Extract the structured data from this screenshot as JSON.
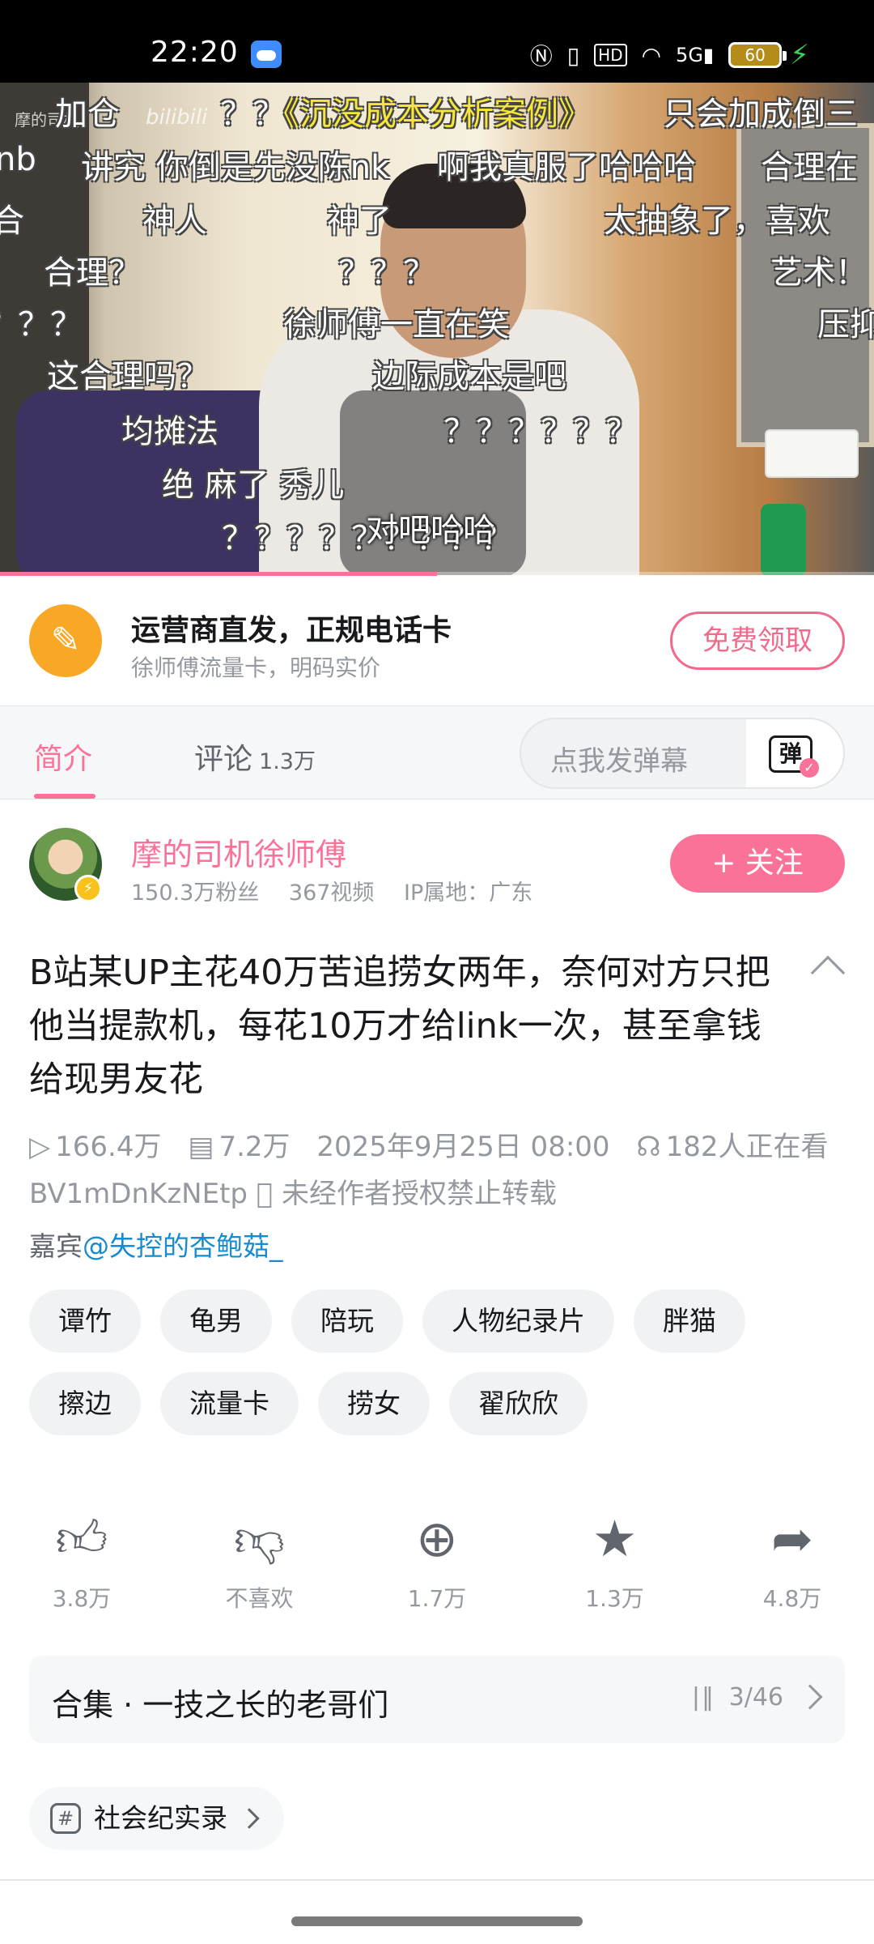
{
  "status_bar": {
    "time": "22:20",
    "battery": "60"
  },
  "video": {
    "watermark": "摩的司机",
    "watermark_logo": "bilibili",
    "subtitle": "对吧哈哈",
    "progress": 0.5,
    "danmaku": [
      {
        "text": "加仓",
        "color": "white"
      },
      {
        "text": "？？",
        "color": "white"
      },
      {
        "text": "《沉没成本分析案例》",
        "color": "yellow"
      },
      {
        "text": "只会加成倒三",
        "color": "white"
      },
      {
        "text": "nb",
        "color": "white"
      },
      {
        "text": "讲究 你倒是先没陈nk",
        "color": "white"
      },
      {
        "text": "啊我真服了哈哈哈",
        "color": "white"
      },
      {
        "text": "合理在",
        "color": "white"
      },
      {
        "text": "合",
        "color": "white"
      },
      {
        "text": "神人",
        "color": "white"
      },
      {
        "text": "神了",
        "color": "white"
      },
      {
        "text": "太抽象了，喜欢",
        "color": "white"
      },
      {
        "text": "合理？",
        "color": "white"
      },
      {
        "text": "？？？",
        "color": "white"
      },
      {
        "text": "艺术！",
        "color": "white"
      },
      {
        "text": "？？？",
        "color": "white"
      },
      {
        "text": "徐师傅一直在笑",
        "color": "white"
      },
      {
        "text": "压抑",
        "color": "white"
      },
      {
        "text": "这合理吗？",
        "color": "white"
      },
      {
        "text": "边际成本是吧",
        "color": "white"
      },
      {
        "text": "均摊法",
        "color": "white"
      },
      {
        "text": "？？？？？？",
        "color": "white"
      },
      {
        "text": "绝 麻了 秀儿",
        "color": "white"
      },
      {
        "text": "？？？？？？？？？",
        "color": "white"
      }
    ]
  },
  "ad": {
    "title": "运营商直发，正规电话卡",
    "subtitle": "徐师傅流量卡，明码实价",
    "button": "免费领取"
  },
  "tabs": {
    "intro": "简介",
    "comments": "评论",
    "comments_count": "1.3万",
    "danmaku_placeholder": "点我发弹幕",
    "danmaku_toggle": "弹"
  },
  "uploader": {
    "name": "摩的司机徐师傅",
    "fans": "150.3万粉丝",
    "videos": "367视频",
    "ip": "IP属地：广东",
    "follow": "+ 关注"
  },
  "video_info": {
    "title": "B站某UP主花40万苦追捞女两年，奈何对方只把他当提款机，每花10万才给link一次，甚至拿钱给现男友花",
    "plays": "166.4万",
    "danmaku_count": "7.2万",
    "date": "2025年9月25日 08:00",
    "watching": "182人正在看",
    "bvid": "BV1mDnKzNEtp",
    "no_reprint": "未经作者授权禁止转载",
    "guest_label": "嘉宾",
    "guest": "@失控的杏鲍菇_"
  },
  "tags": [
    "谭竹",
    "龟男",
    "陪玩",
    "人物纪录片",
    "胖猫",
    "擦边",
    "流量卡",
    "捞女",
    "翟欣欣"
  ],
  "actions": {
    "like": "3.8万",
    "dislike": "不喜欢",
    "coin": "1.7万",
    "favorite": "1.3万",
    "share": "4.8万"
  },
  "collection": {
    "name": "合集 · 一技之长的老哥们",
    "progress": "3/46"
  },
  "category": {
    "label": "社会纪实录"
  },
  "icons": {
    "play": "play-count-icon",
    "danmaku": "danmaku-count-icon",
    "watching": "watching-icon",
    "no_reprint": "forbidden-icon",
    "like": "thumbs-up-icon",
    "dislike": "thumbs-down-icon",
    "coin": "coin-icon",
    "favorite": "star-icon",
    "share": "share-icon"
  },
  "colors": {
    "accent": "#fb7299",
    "link": "#178bcf",
    "warning": "#f03d3d",
    "ad_icon": "#f9a825"
  }
}
